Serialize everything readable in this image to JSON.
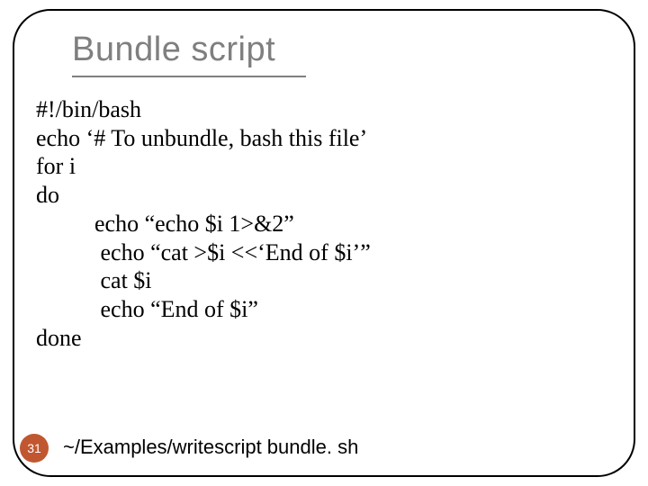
{
  "title": "Bundle script",
  "code_lines": [
    "#!/bin/bash",
    "echo ‘# To unbundle, bash this file’",
    "for i",
    "do",
    "          echo “echo $i 1>&2”",
    "           echo “cat >$i <<‘End of $i’”",
    "           cat $i",
    "           echo “End of $i”",
    "done"
  ],
  "slide_number": "31",
  "footer": "~/Examples/writescript bundle. sh"
}
